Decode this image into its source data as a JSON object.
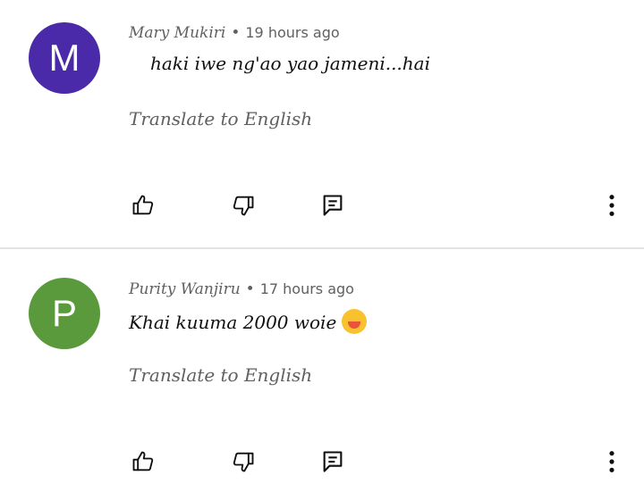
{
  "comments": [
    {
      "avatar_letter": "M",
      "avatar_color": "#4a2aa8",
      "author": "Mary Mukiri",
      "separator": "•",
      "time": "19 hours ago",
      "text": "haki iwe ng'ao yao jameni...hai",
      "translate_label": "Translate to English",
      "actions": {
        "like_icon": "thumb-up-icon",
        "dislike_icon": "thumb-down-icon",
        "reply_icon": "comment-reply-icon",
        "more_icon": "more-vertical-icon"
      }
    },
    {
      "avatar_letter": "P",
      "avatar_color": "#5a9a3c",
      "author": "Purity Wanjiru",
      "separator": "•",
      "time": "17 hours ago",
      "text": "Khai kuuma 2000 woie",
      "emoji": "tired-face-emoji",
      "translate_label": "Translate to English",
      "actions": {
        "like_icon": "thumb-up-icon",
        "dislike_icon": "thumb-down-icon",
        "reply_icon": "comment-reply-icon",
        "more_icon": "more-vertical-icon"
      }
    }
  ]
}
